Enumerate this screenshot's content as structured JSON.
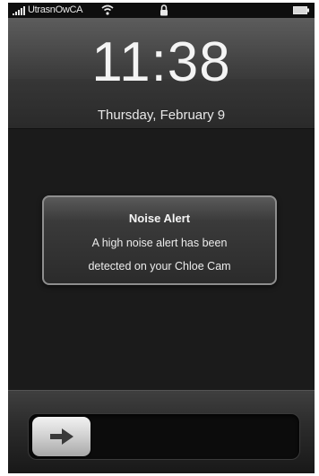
{
  "status_bar": {
    "carrier": "UtrasnOwCA",
    "signal_icon": "signal-bars-icon",
    "wifi_icon": "wifi-icon",
    "lock_icon": "lock-icon",
    "battery_icon": "battery-icon"
  },
  "lock_screen": {
    "time": "11:38",
    "date": "Thursday, February 9"
  },
  "alert": {
    "title": "Noise Alert",
    "message_line_1": "A high noise alert has been",
    "message_line_2": "detected on your Chloe Cam"
  },
  "unlock_slider": {
    "label": "",
    "knob_icon": "right-arrow-icon"
  },
  "colors": {
    "background": "#1b1b1b",
    "alert_border": "#8e8e8e",
    "text": "#f4f4f4"
  }
}
